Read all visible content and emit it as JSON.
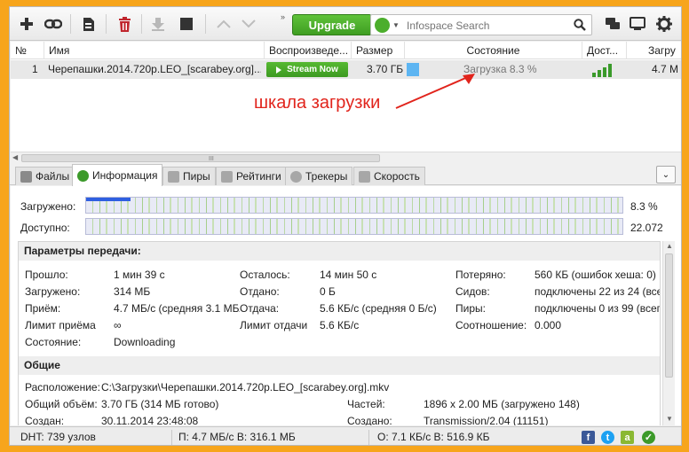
{
  "toolbar": {
    "upgrade_label": "Upgrade",
    "search_placeholder": "Infospace Search",
    "chevron": "»"
  },
  "list": {
    "columns": [
      "№",
      "Имя",
      "Воспроизведе...",
      "Размер",
      "Состояние",
      "Дост...",
      "Загру"
    ],
    "row": {
      "num": "1",
      "name": "Черепашки.2014.720p.LEO_[scarabey.org]....",
      "stream_label": "Stream Now",
      "size": "3.70 ГБ",
      "state": "Загрузка 8.3 %",
      "progress_fraction": 0.083,
      "speed": "4.7 М"
    },
    "scroll_grip": "III"
  },
  "annotation": "шкала загрузки",
  "tabs": [
    "Файлы",
    "Информация",
    "Пиры",
    "Рейтинги",
    "Трекеры",
    "Скорость"
  ],
  "collapse_label": "⌄",
  "progress": {
    "downloaded_label": "Загружено:",
    "downloaded_pct": "8.3 %",
    "downloaded_fraction": 0.083,
    "available_label": "Доступно:",
    "available_value": "22.072"
  },
  "transfer": {
    "title": "Параметры передачи:",
    "col1": [
      {
        "k": "Прошло:",
        "v": "1 мин 39 с"
      },
      {
        "k": "Загружено:",
        "v": "314 МБ"
      },
      {
        "k": "Приём:",
        "v": "4.7 МБ/с (средняя 3.1 МБ/"
      },
      {
        "k": "Лимит приёма",
        "v": "∞"
      },
      {
        "k": "Состояние:",
        "v": "Downloading"
      }
    ],
    "col2": [
      {
        "k": "Осталось:",
        "v": "14 мин 50 с"
      },
      {
        "k": "Отдано:",
        "v": "0 Б"
      },
      {
        "k": "Отдача:",
        "v": "5.6 КБ/с (средняя 0 Б/с)"
      },
      {
        "k": "Лимит отдачи",
        "v": "5.6 КБ/с"
      }
    ],
    "col3": [
      {
        "k": "Потеряно:",
        "v": "560 КБ (ошибок хеша: 0)"
      },
      {
        "k": "Сидов:",
        "v": "подключены 22 из 24 (всег"
      },
      {
        "k": "Пиры:",
        "v": "подключены 0 из 99 (всег"
      },
      {
        "k": "Соотношение:",
        "v": "0.000"
      }
    ]
  },
  "general": {
    "title": "Общие",
    "location_label": "Расположение:",
    "location_value": "C:\\Загрузки\\Черепашки.2014.720p.LEO_[scarabey.org].mkv",
    "total_label": "Общий объём:",
    "total_value": "3.70 ГБ (314 МБ готово)",
    "pieces_label": "Частей:",
    "pieces_value": "1896 x 2.00 МБ (загружено 148)",
    "created_label": "Создан:",
    "created_value": "30.11.2014 23:48:08",
    "created_by_label": "Создано:",
    "created_by_value": "Transmission/2.04 (11151)"
  },
  "status": {
    "dht": "DHT: 739 узлов",
    "down": "П: 4.7 МБ/с В: 316.1 МБ",
    "up": "О: 7.1 КБ/с В: 516.9 КБ"
  },
  "colors": {
    "accent_green": "#3f9e22",
    "progress_blue": "#2f5fe0",
    "annotation_red": "#e1241c",
    "frame_orange": "#f7a51c"
  }
}
